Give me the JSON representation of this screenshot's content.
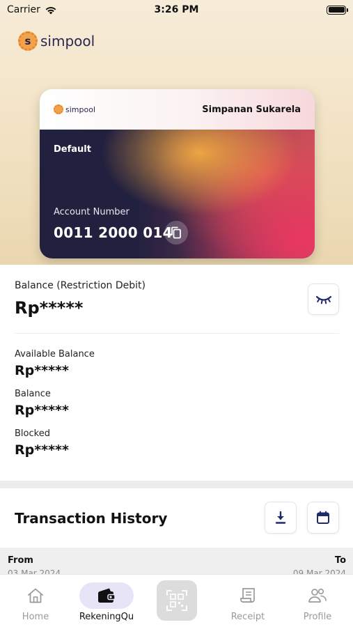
{
  "status_bar": {
    "carrier": "Carrier",
    "time": "3:26 PM"
  },
  "header": {
    "logo_text": "simpool",
    "logo_letter": "s"
  },
  "card": {
    "brand": "simpool",
    "type": "Simpanan Sukarela",
    "label": "Default",
    "account_number_label": "Account Number",
    "account_number": "0011 2000 014"
  },
  "balance": {
    "restriction_label": "Balance (Restriction Debit)",
    "restriction_value": "Rp*****",
    "items": [
      {
        "label": "Available Balance",
        "value": "Rp*****"
      },
      {
        "label": "Balance",
        "value": "Rp*****"
      },
      {
        "label": "Blocked",
        "value": "Rp*****"
      }
    ]
  },
  "transactions": {
    "title": "Transaction History",
    "from_label": "From",
    "to_label": "To",
    "from_date": "03 Mar 2024",
    "to_date": "09 Mar 2024"
  },
  "nav": {
    "items": [
      {
        "label": "Home",
        "icon": "home-icon"
      },
      {
        "label": "RekeningQu",
        "icon": "wallet-icon"
      },
      {
        "label": "",
        "icon": "qr-code-icon"
      },
      {
        "label": "Receipt",
        "icon": "receipt-icon"
      },
      {
        "label": "Profile",
        "icon": "profile-icon"
      }
    ]
  },
  "colors": {
    "brand_navy": "#1f2a6b",
    "accent_orange": "#f0a34a",
    "nav_active_bg": "#e8e4f7"
  }
}
